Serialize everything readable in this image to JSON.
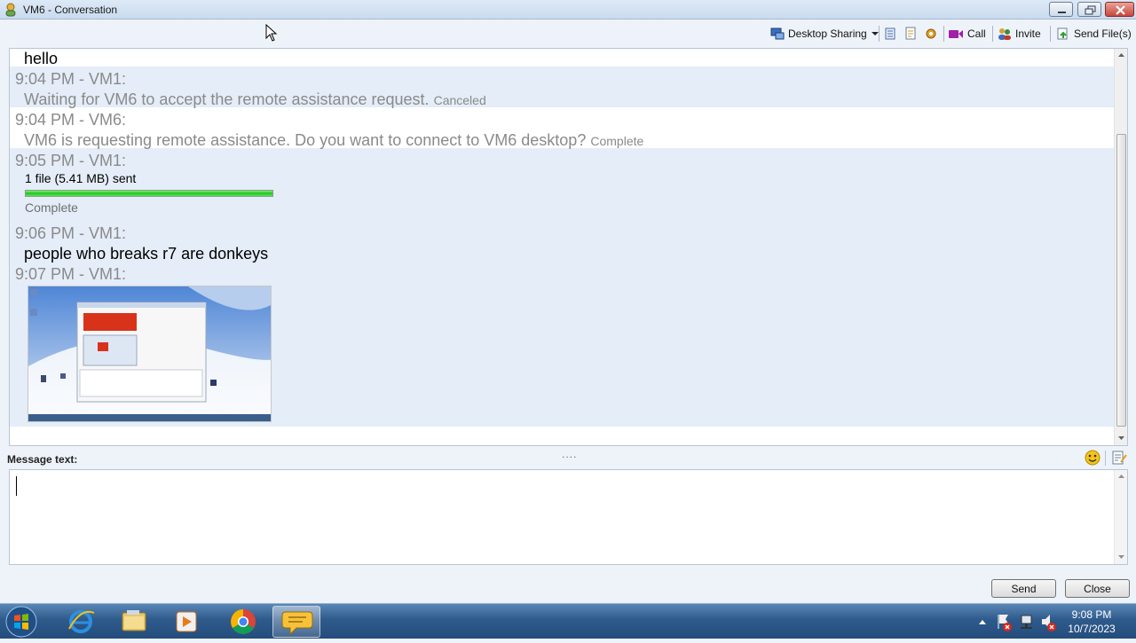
{
  "window": {
    "title": "VM6 - Conversation"
  },
  "toolbar": {
    "desktop_sharing": "Desktop Sharing",
    "call": "Call",
    "invite": "Invite",
    "send_files": "Send File(s)"
  },
  "conversation": {
    "first_message": "hello",
    "messages": [
      {
        "header": "9:04 PM - VM1:",
        "text": "Waiting for VM6 to accept the remote assistance request.",
        "status": "Canceled"
      },
      {
        "header": "9:04 PM - VM6:",
        "text": "VM6 is requesting remote assistance. Do you want to connect to VM6 desktop?",
        "status": "Complete"
      },
      {
        "header": "9:05 PM - VM1:",
        "file_text": "1 file (5.41 MB) sent",
        "progress": 1.0,
        "status": "Complete"
      },
      {
        "header": "9:06 PM - VM1:",
        "text": "people who breaks r7 are donkeys"
      },
      {
        "header": "9:07 PM - VM1:",
        "image": "desktop-screenshot-thumbnail"
      }
    ]
  },
  "composer": {
    "label": "Message text:",
    "value": "",
    "send_label": "Send",
    "close_label": "Close"
  },
  "taskbar": {
    "apps": [
      "start-orb",
      "internet-explorer-icon",
      "file-explorer-icon",
      "media-player-icon",
      "chrome-icon",
      "chat-app-icon"
    ],
    "clock_time": "9:08 PM",
    "clock_date": "10/7/2023"
  },
  "colors": {
    "band": "#e4edf8",
    "progress": "#21c521",
    "header_text": "#8a8a8a"
  }
}
